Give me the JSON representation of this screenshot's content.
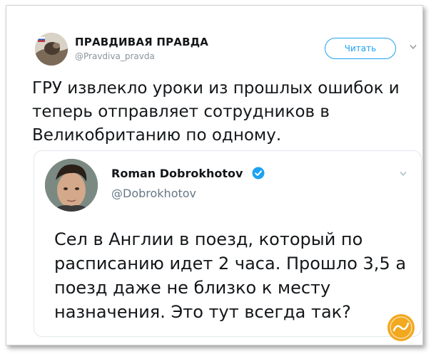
{
  "tweet": {
    "author_name": "ПРАВДИВАЯ ПРАВДА",
    "author_handle": "@Pravdiva_pravda",
    "follow_label": "Читать",
    "text": "ГРУ извлекло уроки из прошлых ошибок и теперь отправляет сотрудников в Великобританию по одному."
  },
  "quoted": {
    "author_name": "Roman Dobrokhotov",
    "author_handle": "@Dobrokhotov",
    "text": "Сел в Англии в поезд, который по расписанию идет 2 часа. Прошло 3,5 а поезд даже не близко к месту назначения. Это тут всегда так?",
    "verified": true
  },
  "icons": {
    "menu": "chevron-down-icon",
    "verified": "verified-badge-icon",
    "watermark": "site-logo"
  },
  "colors": {
    "accent": "#1da1f2",
    "text": "#14171a",
    "muted": "#657786",
    "border": "#e1e8ed",
    "watermark": "#f2a81f"
  }
}
